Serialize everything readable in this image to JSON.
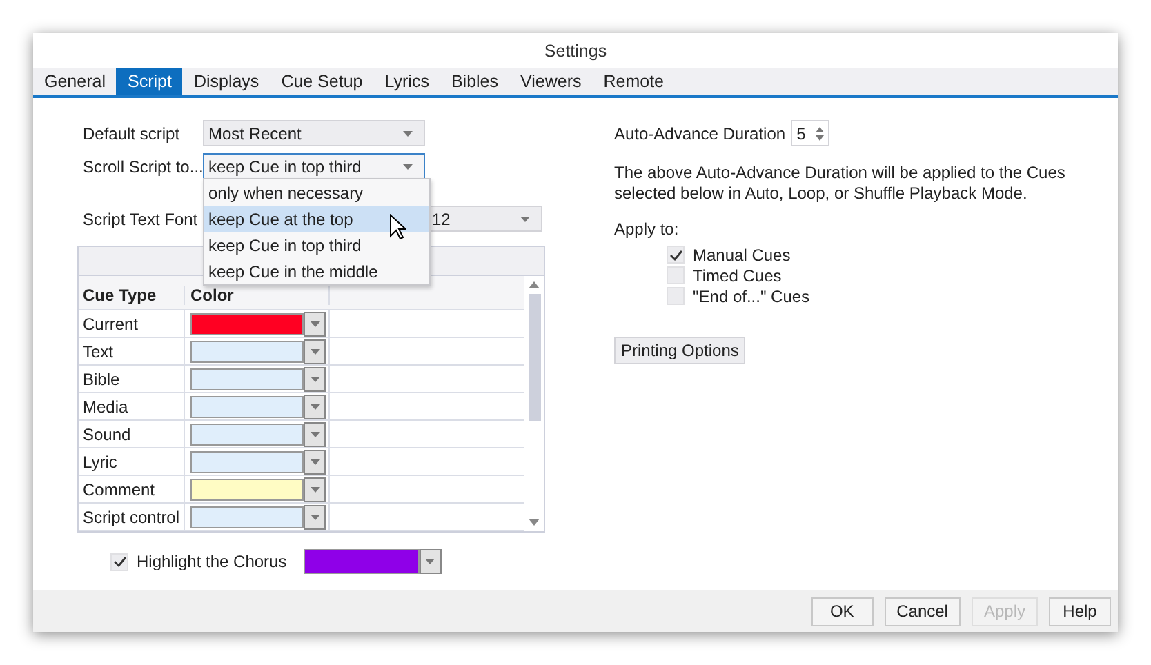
{
  "window": {
    "title": "Settings"
  },
  "tabs": [
    {
      "label": "General",
      "selected": false
    },
    {
      "label": "Script",
      "selected": true
    },
    {
      "label": "Displays",
      "selected": false
    },
    {
      "label": "Cue Setup",
      "selected": false
    },
    {
      "label": "Lyrics",
      "selected": false
    },
    {
      "label": "Bibles",
      "selected": false
    },
    {
      "label": "Viewers",
      "selected": false
    },
    {
      "label": "Remote",
      "selected": false
    }
  ],
  "default_script": {
    "label": "Default script",
    "value": "Most Recent"
  },
  "scroll_script": {
    "label": "Scroll Script to...",
    "value": "keep Cue in top third",
    "expanded": true,
    "options": [
      {
        "label": "only when necessary",
        "highlighted": false
      },
      {
        "label": "keep Cue at the top",
        "highlighted": true
      },
      {
        "label": "keep Cue in top third",
        "highlighted": false
      },
      {
        "label": "keep Cue in the middle",
        "highlighted": false
      }
    ]
  },
  "script_text_font": {
    "label": "Script Text Font",
    "size": "12"
  },
  "cue_table": {
    "columns": [
      "Cue Type",
      "Color"
    ],
    "rows": [
      {
        "cue_type": "Current",
        "color": "#ff0022"
      },
      {
        "cue_type": "Text",
        "color": "#e0eefb"
      },
      {
        "cue_type": "Bible",
        "color": "#e0eefb"
      },
      {
        "cue_type": "Media",
        "color": "#e0eefb"
      },
      {
        "cue_type": "Sound",
        "color": "#e0eefb"
      },
      {
        "cue_type": "Lyric",
        "color": "#e0eefb"
      },
      {
        "cue_type": "Comment",
        "color": "#fffcc4"
      },
      {
        "cue_type": "Script control",
        "color": "#e0eefb"
      }
    ]
  },
  "highlight_chorus": {
    "label": "Highlight the Chorus",
    "checked": true,
    "color": "#8f00e8"
  },
  "auto_advance": {
    "label": "Auto-Advance Duration",
    "value": "5"
  },
  "description": "The above Auto-Advance Duration will be applied to the Cues selected below in Auto, Loop, or Shuffle Playback Mode.",
  "apply_to": {
    "label": "Apply to:",
    "options": [
      {
        "label": "Manual Cues",
        "checked": true
      },
      {
        "label": "Timed Cues",
        "checked": false
      },
      {
        "label": "\"End of...\" Cues",
        "checked": false
      }
    ]
  },
  "printing_options": "Printing Options",
  "buttons": [
    {
      "label": "OK",
      "disabled": false
    },
    {
      "label": "Cancel",
      "disabled": false
    },
    {
      "label": "Apply",
      "disabled": true
    },
    {
      "label": "Help",
      "disabled": false
    }
  ]
}
